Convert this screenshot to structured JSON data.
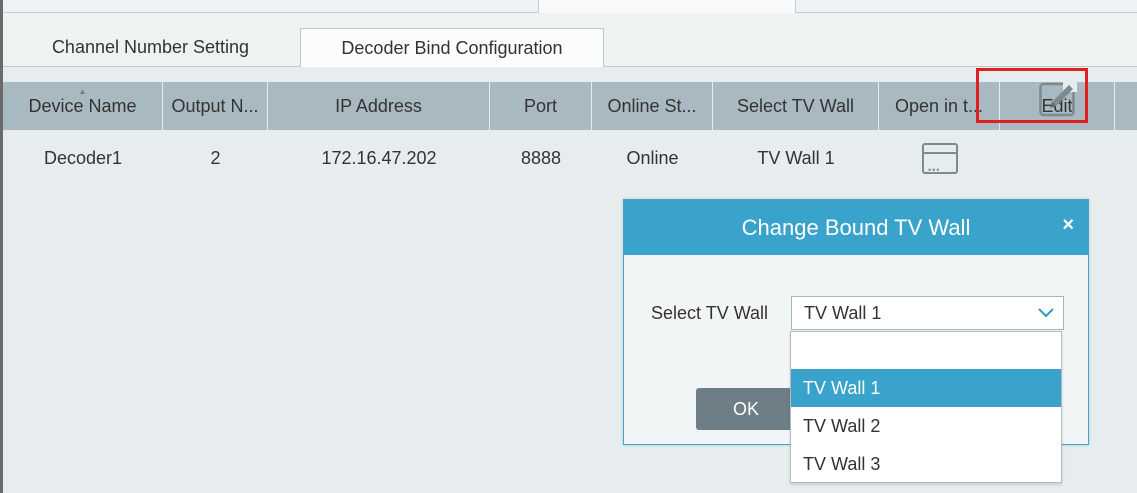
{
  "tabs": [
    {
      "label": "Channel Number Setting",
      "active": false
    },
    {
      "label": "Decoder Bind Configuration",
      "active": true
    }
  ],
  "grid": {
    "columns": [
      "Device Name",
      "Output N...",
      "IP Address",
      "Port",
      "Online St...",
      "Select TV Wall",
      "Open in t...",
      "Edit"
    ],
    "sort_column": "Device Name",
    "rows": [
      {
        "device_name": "Decoder1",
        "output_number": "2",
        "ip_address": "172.16.47.202",
        "port": "8888",
        "online_status": "Online",
        "tv_wall": "TV Wall 1",
        "open_icon": "window-icon",
        "edit_icon": "edit-pencil-icon"
      }
    ]
  },
  "dialog": {
    "title": "Change Bound TV Wall",
    "close_symbol": "×",
    "select_label": "Select TV Wall",
    "select_value": "TV Wall 1",
    "ok_label": "OK",
    "dropdown_options": [
      "",
      "TV Wall 1",
      "TV Wall 2",
      "TV Wall 3"
    ],
    "dropdown_selected": "TV Wall 1"
  },
  "colors": {
    "accent": "#39a3cb",
    "header_bg": "#a9b9c1",
    "highlight": "#e02020",
    "button": "#6e7e86"
  }
}
